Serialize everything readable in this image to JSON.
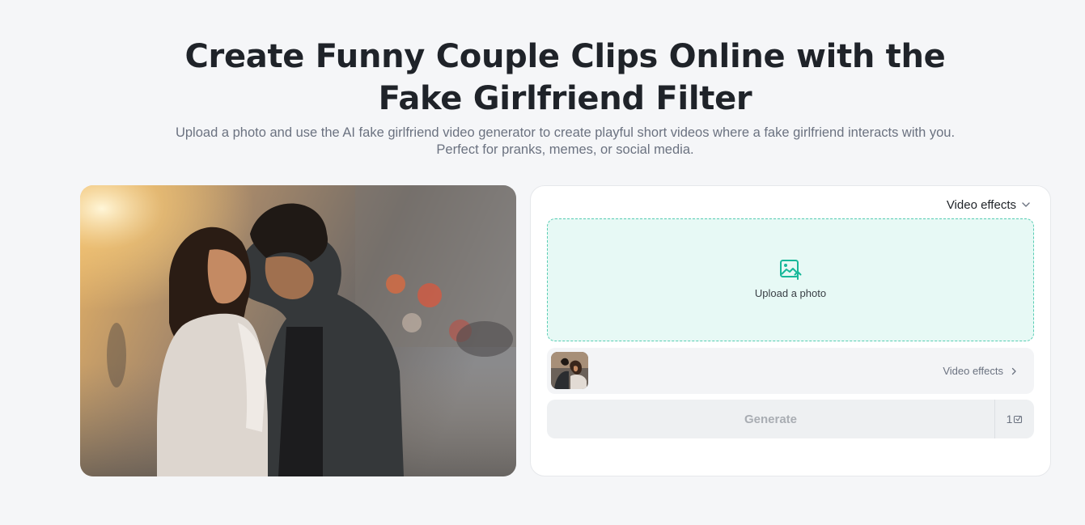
{
  "hero": {
    "title": "Create Funny Couple Clips Online with the Fake Girlfriend Filter",
    "subtitle": "Upload a photo and use the AI fake girlfriend video generator to create playful short videos where a fake girlfriend interacts with you. Perfect for pranks, memes, or social media."
  },
  "panel": {
    "effects_dropdown_label": "Video effects",
    "upload_label": "Upload a photo",
    "effects_link_label": "Video effects",
    "generate_label": "Generate",
    "credits_count": "1"
  },
  "icons": {
    "dropdown": "chevron-down-icon",
    "upload": "image-upload-icon",
    "link": "chevron-right-icon",
    "credits": "coin-icon"
  },
  "colors": {
    "upload_bg": "#e7f9f5",
    "upload_border": "#58cdb3",
    "accent": "#18b89a"
  }
}
